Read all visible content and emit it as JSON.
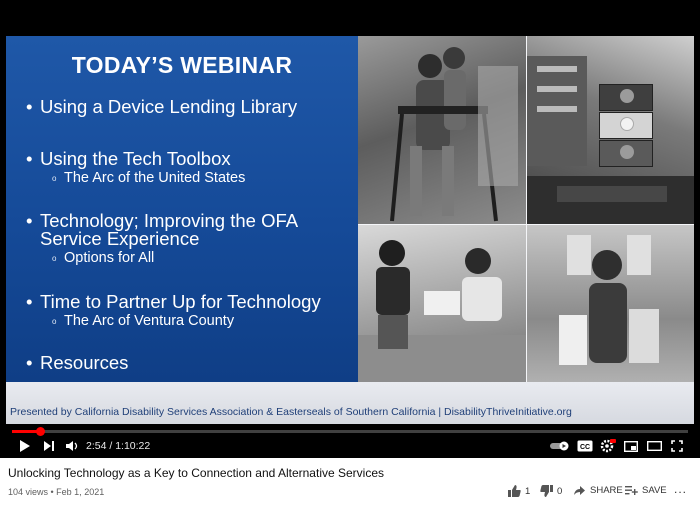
{
  "slide": {
    "title": "TODAY’S WEBINAR",
    "bullet_dot": "•",
    "sub_dot": "o",
    "bullets": [
      {
        "text": "Using a Device Lending Library"
      },
      {
        "text": "Using the Tech Toolbox",
        "sub": "The Arc of the United States"
      },
      {
        "text_lines": [
          "Technology; Improving the OFA",
          "Service Experience"
        ],
        "sub": "Options for All"
      },
      {
        "text": "Time to Partner Up for Technology",
        "sub": "The Arc of Ventura County"
      },
      {
        "text": "Resources"
      }
    ],
    "footer": "Presented by California Disability Services Association & Easterseals of Southern California | DisabilityThriveInitiative.org"
  },
  "player": {
    "current_time": "2:54",
    "duration": "1:10:22",
    "time_display": "2:54 / 1:10:22",
    "progress_fraction": 0.041,
    "accent_color": "#ff0000",
    "controls": [
      "play-icon",
      "next-icon",
      "volume-icon",
      "autoplay-toggle",
      "captions-icon",
      "settings-icon",
      "miniplayer-icon",
      "theater-icon",
      "fullscreen-icon"
    ]
  },
  "video": {
    "title": "Unlocking Technology as a Key to Connection and Alternative Services",
    "views": "104 views",
    "separator": "•",
    "date": "Feb 1, 2021",
    "meta": "104 views • Feb 1, 2021",
    "likes": "1",
    "dislikes": "0",
    "share_label": "SHARE",
    "save_label": "SAVE",
    "more_label": "..."
  }
}
